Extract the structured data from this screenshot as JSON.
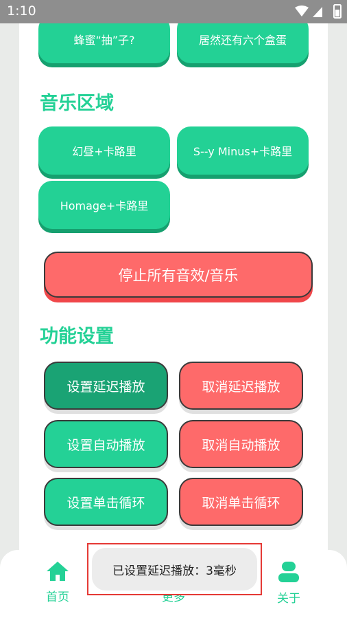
{
  "status_bar": {
    "time": "1:10"
  },
  "sound_buttons": [
    {
      "label": "蜂蜜“抽”子?"
    },
    {
      "label": "居然还有六个盒蛋"
    }
  ],
  "music_section": {
    "title": "音乐区域",
    "buttons": [
      {
        "label": "幻昼+卡路里"
      },
      {
        "label": "S--y Minus+卡路里"
      },
      {
        "label": "Homage+卡路里"
      }
    ]
  },
  "stop_all_label": "停止所有音效/音乐",
  "settings_section": {
    "title": "功能设置",
    "buttons": [
      {
        "label": "设置延迟播放"
      },
      {
        "label": "取消延迟播放"
      },
      {
        "label": "设置自动播放"
      },
      {
        "label": "取消自动播放"
      },
      {
        "label": "设置单击循环"
      },
      {
        "label": "取消单击循环"
      }
    ]
  },
  "bottom_nav": {
    "items": [
      {
        "label": "首页",
        "icon": "home-icon"
      },
      {
        "label": "更多",
        "icon": "more-icon"
      },
      {
        "label": "关于",
        "icon": "person-icon"
      }
    ]
  },
  "toast": {
    "message": "已设置延迟播放：3毫秒"
  },
  "colors": {
    "accent": "#24d196",
    "accent_dark": "#1aa374",
    "danger": "#fe6a6a",
    "toast_border": "#e53935"
  }
}
